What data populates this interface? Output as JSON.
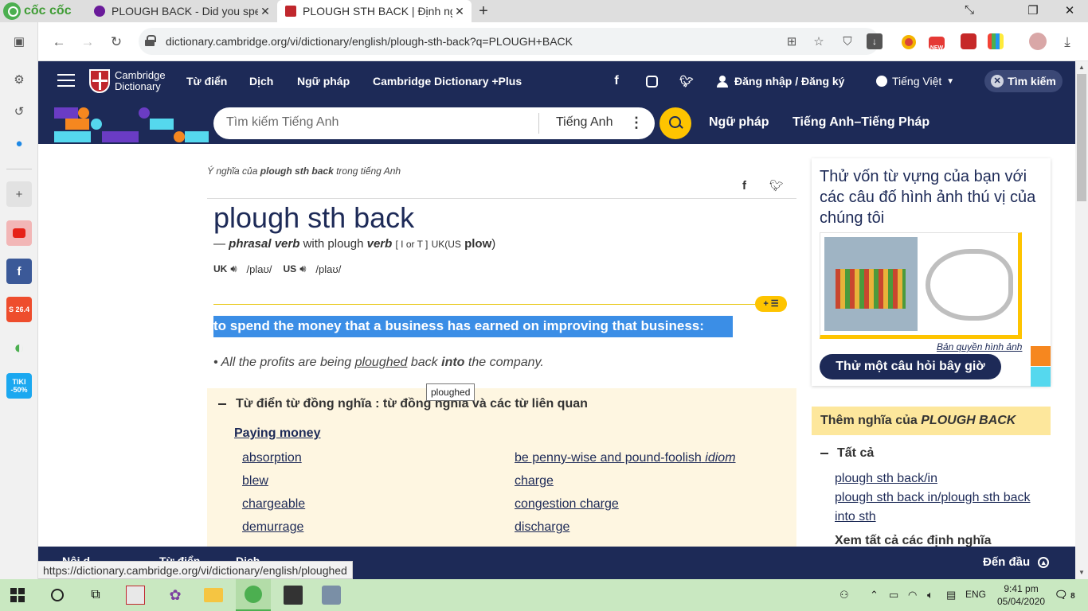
{
  "browser": {
    "brand": "cốc cốc",
    "tabs": [
      {
        "title": "PLOUGH BACK - Did you spel",
        "close": "✕"
      },
      {
        "title": "PLOUGH STH BACK | Định ng",
        "close": "✕"
      }
    ],
    "new_tab": "+",
    "window_controls": [
      "⤡",
      "❐",
      "✕"
    ],
    "url": "dictionary.cambridge.org/vi/dictionary/english/plough-sth-back?q=PLOUGH+BACK",
    "extension_badge": "NEW",
    "status_url": "https://dictionary.cambridge.org/vi/dictionary/english/ploughed"
  },
  "sidebar_badges": {
    "tiki": "TIKI -50%",
    "shopee": "S 26.4"
  },
  "header": {
    "logo_line1": "Cambridge",
    "logo_line2": "Dictionary",
    "nav": [
      "Từ điển",
      "Dịch",
      "Ngữ pháp",
      "Cambridge Dictionary +Plus"
    ],
    "login": "Đăng nhập / Đăng ký",
    "language": "Tiếng Việt",
    "close_search": "Tìm kiếm"
  },
  "search": {
    "placeholder": "Tìm kiếm Tiếng Anh",
    "language": "Tiếng Anh",
    "links": [
      "Ngữ pháp",
      "Tiếng Anh–Tiếng Pháp"
    ]
  },
  "entry": {
    "meaning_of_prefix": "Ý nghĩa của",
    "meaning_of_word": "plough sth back",
    "meaning_of_suffix": "trong tiếng Anh",
    "headword": "plough sth back",
    "pos_dash": "—",
    "pos": "phrasal verb",
    "pos_with": "with plough",
    "pos_verb": "verb",
    "grammar": "[ I or T ]",
    "region_uk": "UK",
    "us_open": "(US",
    "us_word": "plow",
    "us_close": ")",
    "pron": [
      {
        "region": "UK",
        "ipa": "/plaʊ/"
      },
      {
        "region": "US",
        "ipa": "/plaʊ/"
      }
    ],
    "definition_tag": "+ ☰",
    "definition": "to spend the money that a business has earned on improving that business:",
    "example": {
      "bullet": "•",
      "before": "All the profits are being",
      "link": "ploughed",
      "middle": "back",
      "bold": "into",
      "after": "the company."
    },
    "tooltip": "ploughed"
  },
  "thesaurus": {
    "title": "Từ điển từ đồng nghĩa : từ đồng nghĩa và các từ liên quan",
    "category": "Paying money",
    "left": [
      "absorption",
      "blew",
      "chargeable",
      "demurrage"
    ],
    "right": [
      {
        "text": "be penny-wise and pound-foolish",
        "tag": "idiom"
      },
      {
        "text": "charge",
        "tag": ""
      },
      {
        "text": "congestion charge",
        "tag": ""
      },
      {
        "text": "discharge",
        "tag": ""
      }
    ]
  },
  "side": {
    "quiz_title": "Thử vốn từ vựng của bạn với các câu đố hình ảnh thú vị của chúng tôi",
    "copyright": "Bản quyền hình ảnh",
    "quiz_button": "Thử một câu hỏi bây giờ",
    "more_prefix": "Thêm nghĩa của",
    "more_word": "PLOUGH BACK",
    "all": "Tất cả",
    "links": [
      "plough sth back/in",
      "plough sth back in/plough sth back",
      "into sth"
    ],
    "see_all": "Xem tất cả các định nghĩa"
  },
  "bottom_bar": {
    "to_top": "Đến đầu",
    "clipped": [
      "Nội d",
      "Từ điển",
      "Dịch"
    ]
  },
  "taskbar": {
    "lang": "ENG",
    "time": "9:41 pm",
    "date": "05/04/2020",
    "notif": "8"
  }
}
